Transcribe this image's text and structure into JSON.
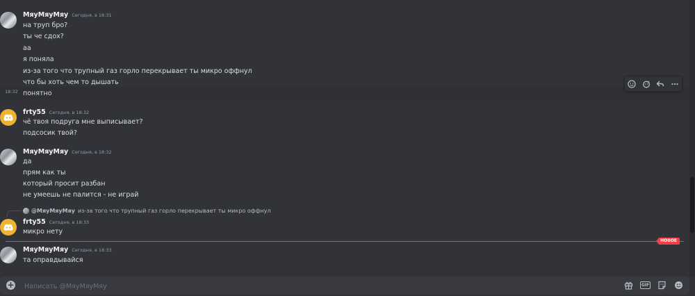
{
  "messages": [
    {
      "author": "МяуМяуМяу",
      "time": "Сегодня, в 18:31",
      "lines": [
        "на труп бро?",
        "ты че сдох?",
        "аа",
        "я поняла",
        "из-за того что трупный газ горло перекрывает ты микро оффнул",
        "что бы хоть чем то дышать",
        "понятно"
      ],
      "hover_time": "18:32"
    },
    {
      "author": "frty55",
      "time": "Сегодня, в 18:32",
      "lines": [
        "чё твоя подруга мне выписывает?",
        "подсосик твой?"
      ]
    },
    {
      "author": "МяуМяуМяу",
      "time": "Сегодня, в 18:32",
      "lines": [
        "да",
        "прям как ты",
        "который просит разбан",
        "не умеешь не палится - не играй"
      ]
    },
    {
      "reply_to": {
        "author": "@МяуМяуМяу",
        "text": "из-за того что трупный газ горло перекрывает ты микро оффнул"
      },
      "author": "frty55",
      "time": "Сегодня, в 18:33",
      "lines": [
        "микро нету"
      ]
    },
    {
      "author": "МяуМяуМяу",
      "time": "Сегодня, в 18:33",
      "lines": [
        "та оправдывайся"
      ]
    }
  ],
  "new_badge": "НОВОЕ",
  "composer": {
    "placeholder": "Написать @МяуМяуМяу",
    "gif_label": "GIF"
  },
  "toolbar_icons": [
    "add-reaction-icon",
    "add-super-reaction-icon",
    "reply-icon",
    "more-icon"
  ],
  "composer_icons": [
    "gift-icon",
    "gif-icon",
    "sticker-icon",
    "emoji-icon"
  ],
  "colors": {
    "background": "#313338",
    "composer": "#383a40",
    "new_divider": "#f23f43",
    "discord_avatar": "#f0b232"
  }
}
